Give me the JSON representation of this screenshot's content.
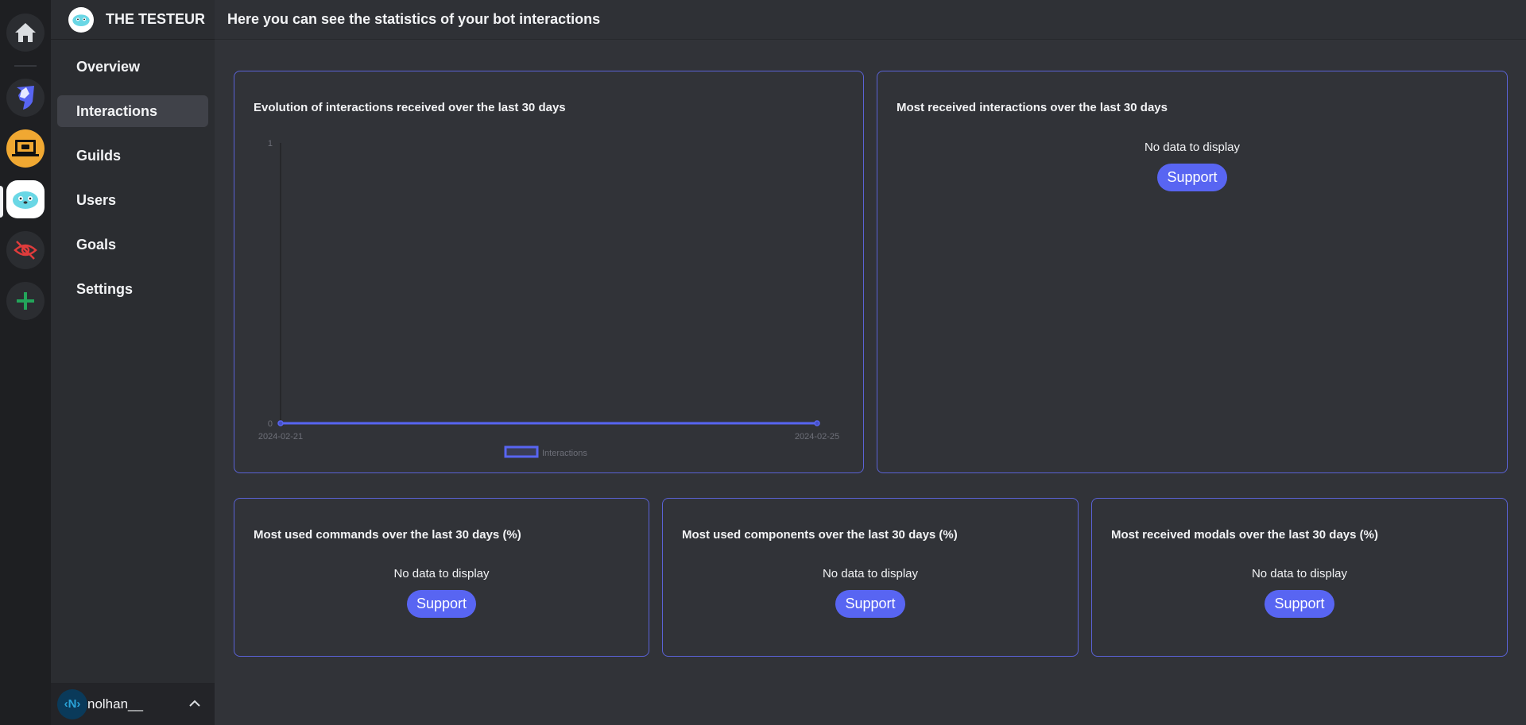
{
  "rail": {
    "items": [
      {
        "name": "home",
        "icon": "home-icon"
      },
      {
        "name": "server-unicorn-shield",
        "icon": "unicorn-shield-icon"
      },
      {
        "name": "server-robot-laptop",
        "icon": "robot-laptop-icon"
      },
      {
        "name": "server-the-testeur",
        "icon": "gopher-icon",
        "active": true
      },
      {
        "name": "server-hidden",
        "icon": "eye-slash-icon"
      },
      {
        "name": "add-server",
        "icon": "plus-icon"
      }
    ]
  },
  "sidebar": {
    "bot_name": "THE TESTEUR",
    "items": [
      {
        "label": "Overview",
        "active": false
      },
      {
        "label": "Interactions",
        "active": true
      },
      {
        "label": "Guilds",
        "active": false
      },
      {
        "label": "Users",
        "active": false
      },
      {
        "label": "Goals",
        "active": false
      },
      {
        "label": "Settings",
        "active": false
      }
    ],
    "user": {
      "name": "nolhan__",
      "avatar_text": "‹N›"
    }
  },
  "header": {
    "title": "Here you can see the statistics of your bot interactions"
  },
  "colors": {
    "accent": "#5865f2",
    "card_border": "#5a62d6",
    "line": "#5865f2",
    "active_nav": "#404249"
  },
  "cards": {
    "evolution": {
      "title": "Evolution of interactions received over the last 30 days"
    },
    "most_received": {
      "title": "Most received interactions over the last 30 days",
      "empty": "No data to display",
      "button": "Support"
    },
    "commands": {
      "title": "Most used commands over the last 30 days (%)",
      "empty": "No data to display",
      "button": "Support"
    },
    "components": {
      "title": "Most used components over the last 30 days (%)",
      "empty": "No data to display",
      "button": "Support"
    },
    "modals": {
      "title": "Most received modals over the last 30 days (%)",
      "empty": "No data to display",
      "button": "Support"
    }
  },
  "chart_data": {
    "type": "line",
    "title": "Evolution of interactions received over the last 30 days",
    "x": [
      "2024-02-21",
      "2024-02-25"
    ],
    "series": [
      {
        "name": "Interactions",
        "values": [
          0,
          0
        ]
      }
    ],
    "yticks": [
      "0",
      "1"
    ],
    "ylim": [
      0,
      1
    ],
    "xlabel": "",
    "ylabel": "",
    "legend": "bottom",
    "grid": false
  }
}
